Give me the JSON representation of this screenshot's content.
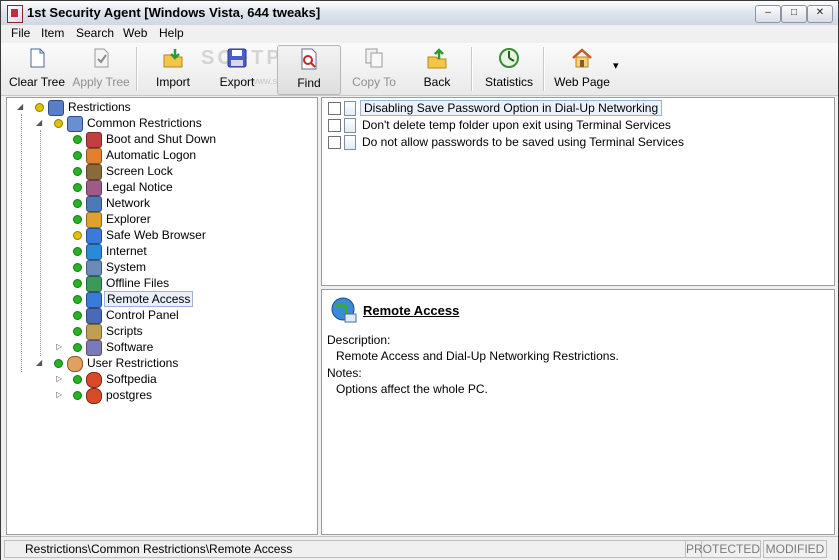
{
  "window": {
    "title": "1st Security Agent [Windows Vista, 644 tweaks]",
    "buttons": {
      "minimize": "–",
      "maximize": "□",
      "close": "✕"
    }
  },
  "menu": [
    "File",
    "Item",
    "Search",
    "Web",
    "Help"
  ],
  "toolbar": {
    "clear_tree": "Clear Tree",
    "apply_tree": "Apply Tree",
    "import": "Import",
    "export": "Export",
    "find": "Find",
    "copy_to": "Copy To",
    "back": "Back",
    "statistics": "Statistics",
    "web_page": "Web Page",
    "dropdown": "▾"
  },
  "watermark": {
    "text": "SOFTPEDIA",
    "sub": "www.softpedia.com"
  },
  "tree": {
    "root": "Restrictions",
    "common": "Common Restrictions",
    "children": [
      "Boot and Shut Down",
      "Automatic Logon",
      "Screen Lock",
      "Legal Notice",
      "Network",
      "Explorer",
      "Safe Web Browser",
      "Internet",
      "System",
      "Offline Files",
      "Remote Access",
      "Control Panel",
      "Scripts",
      "Software"
    ],
    "user": "User Restrictions",
    "users": [
      "Softpedia",
      "postgres"
    ],
    "selected": "Remote Access",
    "expand_icon": "◢",
    "collapse_icon": "▷"
  },
  "items": [
    "Disabling Save Password Option in Dial-Up Networking",
    "Don't delete temp folder upon exit using Terminal Services",
    "Do not allow passwords to be saved using Terminal Services"
  ],
  "detail": {
    "title": "Remote Access",
    "description_label": "Description:",
    "description": "Remote Access and Dial-Up Networking Restrictions.",
    "notes_label": "Notes:",
    "notes": "Options affect the whole PC."
  },
  "status": {
    "path": "Restrictions\\Common Restrictions\\Remote Access",
    "protected": "PROTECTED",
    "modified": "MODIFIED"
  },
  "colors": {
    "dot_green": "#22b522",
    "dot_yellow": "#e0c000",
    "accent_blue": "#2e6db4"
  }
}
